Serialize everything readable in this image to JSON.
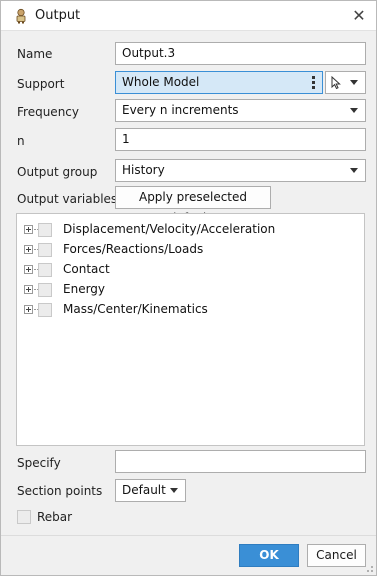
{
  "window": {
    "title": "Output",
    "icon": "output-person-icon",
    "close_glyph": "✕"
  },
  "form": {
    "name": {
      "label": "Name",
      "value": "Output.3"
    },
    "support": {
      "label": "Support",
      "value": "Whole Model",
      "pick_icon": "cursor-arrow-icon"
    },
    "frequency": {
      "label": "Frequency",
      "value": "Every n increments"
    },
    "n": {
      "label": "n",
      "value": "1"
    },
    "output_group": {
      "label": "Output group",
      "value": "History"
    },
    "output_variables": {
      "label": "Output variables",
      "button": "Apply preselected defaults"
    }
  },
  "tree": {
    "items": [
      {
        "label": "Displacement/Velocity/Acceleration"
      },
      {
        "label": "Forces/Reactions/Loads"
      },
      {
        "label": "Contact"
      },
      {
        "label": "Energy"
      },
      {
        "label": "Mass/Center/Kinematics"
      }
    ]
  },
  "specify": {
    "label": "Specify",
    "value": ""
  },
  "section_points": {
    "label": "Section points",
    "value": "Default"
  },
  "rebar": {
    "label": "Rebar"
  },
  "buttons": {
    "ok": "OK",
    "cancel": "Cancel"
  },
  "colors": {
    "accent": "#3a8fd6",
    "selected_field": "#d5e8f7"
  }
}
